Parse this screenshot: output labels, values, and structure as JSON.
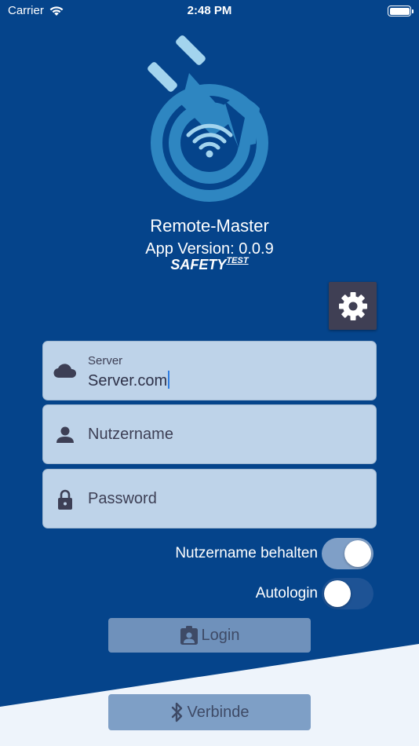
{
  "status_bar": {
    "carrier": "Carrier",
    "time": "2:48 PM"
  },
  "app": {
    "title": "Remote-Master",
    "version": "App Version: 0.0.9",
    "brand": "SAFETY",
    "brand_sup": "TEST"
  },
  "settings": {
    "icon": "gear-icon"
  },
  "server": {
    "label": "Server",
    "value": "Server.com",
    "icon": "cloud-icon"
  },
  "username": {
    "placeholder": "Nutzername",
    "icon": "person-icon"
  },
  "password": {
    "placeholder": "Password",
    "icon": "lock-icon"
  },
  "keep_username": {
    "label": "Nutzername behalten",
    "on": true
  },
  "autologin": {
    "label": "Autologin",
    "on": false
  },
  "login_button": {
    "label": "Login",
    "icon": "badge-icon"
  },
  "connect_button": {
    "label": "Verbinde",
    "icon": "bluetooth-icon"
  },
  "colors": {
    "background": "#05448b",
    "field": "#bed3e9",
    "settings_button": "#3f3f54",
    "bottom_panel": "#eef4fb"
  }
}
